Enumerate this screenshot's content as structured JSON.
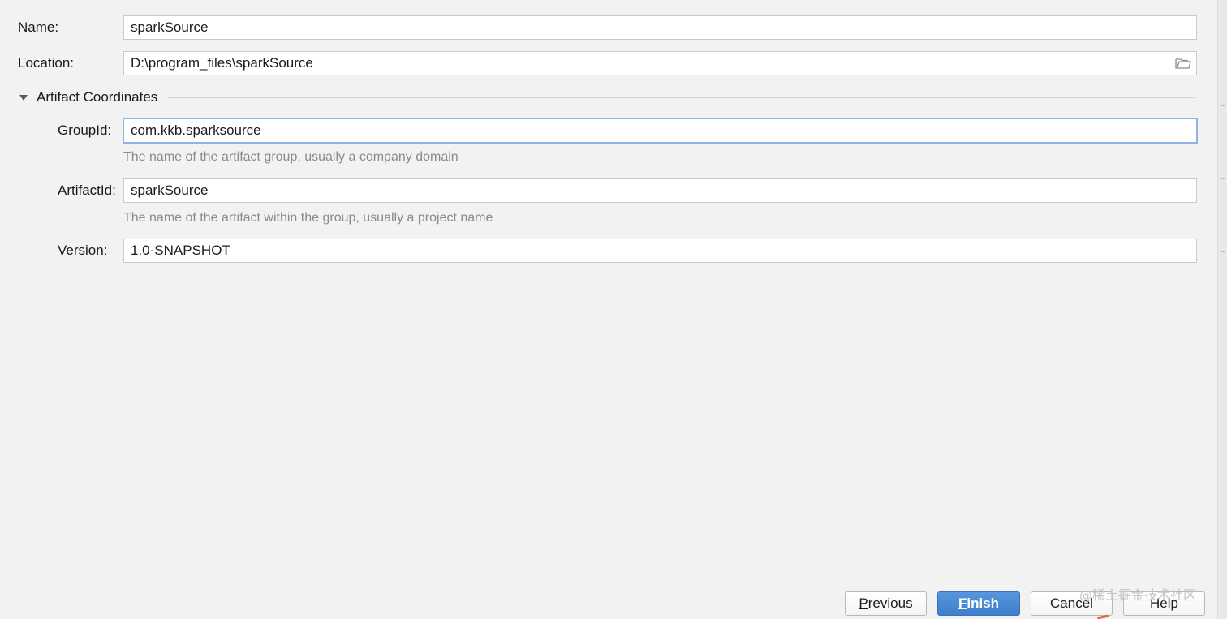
{
  "form": {
    "name": {
      "label": "Name:",
      "value": "sparkSource"
    },
    "location": {
      "label": "Location:",
      "value": "D:\\program_files\\sparkSource"
    }
  },
  "artifact": {
    "section_title": "Artifact Coordinates",
    "group_id": {
      "label": "GroupId:",
      "value": "com.kkb.sparksource",
      "hint": "The name of the artifact group, usually a company domain"
    },
    "artifact_id": {
      "label": "ArtifactId:",
      "value": "sparkSource",
      "hint": "The name of the artifact within the group, usually a project name"
    },
    "version": {
      "label": "Version:",
      "value": "1.0-SNAPSHOT"
    }
  },
  "buttons": {
    "previous": {
      "mnemonic": "P",
      "rest": "revious"
    },
    "finish": {
      "mnemonic": "F",
      "rest": "inish"
    },
    "cancel": "Cancel",
    "help": "Help"
  },
  "watermark": "@稀土掘金技术社区",
  "icons": {
    "location_browse": "folder-icon",
    "section_toggle": "triangle-down-icon"
  },
  "colors": {
    "background": "#f2f2f2",
    "focus_border": "#8fb3e6",
    "primary_button": "#4a8bd4",
    "hint_text": "#8a8a8a"
  }
}
